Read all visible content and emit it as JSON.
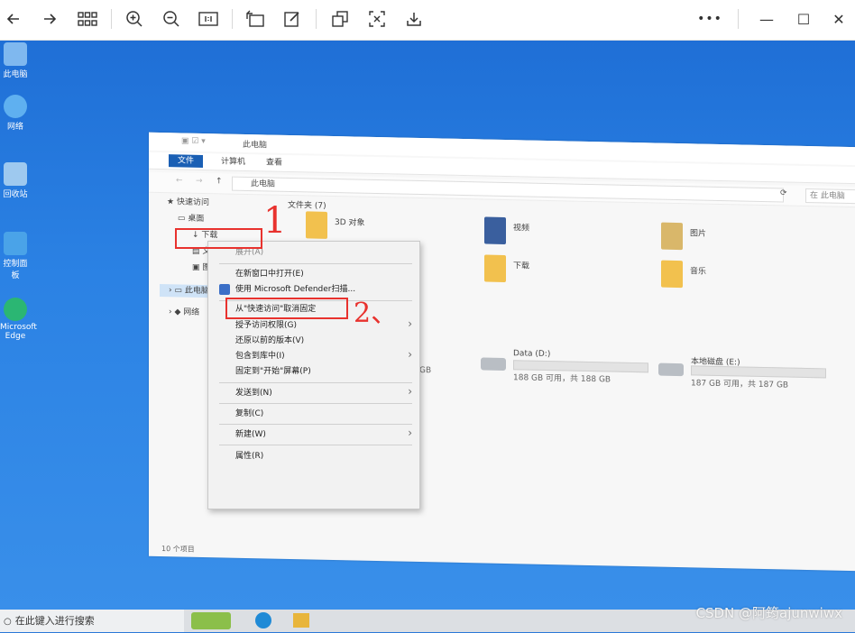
{
  "viewer": {
    "toolbar_icons": [
      "arrow-left-icon",
      "arrow-right-icon",
      "grid-icon",
      "zoom-in-icon",
      "zoom-out-icon",
      "actual-size-icon",
      "rotate-icon",
      "edit-icon",
      "crop-icon",
      "fit-icon",
      "save-icon"
    ],
    "more_label": "•••",
    "minimize_label": "—",
    "maximize_label": "☐",
    "close_label": "✕"
  },
  "desktop": {
    "icons": [
      {
        "label": "此电脑"
      },
      {
        "label": "网络"
      },
      {
        "label": "回收站"
      },
      {
        "label": "控制面板"
      },
      {
        "label": "Microsoft Edge"
      }
    ]
  },
  "explorer": {
    "title": "此电脑",
    "ribbon": {
      "file": "文件",
      "computer": "计算机",
      "view": "查看"
    },
    "address": "此电脑",
    "search_placeholder": "在 此电脑",
    "nav": {
      "quick_access": "快速访问",
      "desktop": "桌面",
      "downloads": "下载",
      "documents": "文档",
      "pictures": "图片",
      "this_pc": "此电脑",
      "network": "网络"
    },
    "folders_header": "文件夹 (7)",
    "folders": [
      {
        "name": "3D 对象"
      },
      {
        "name": "视频"
      },
      {
        "name": "图片"
      },
      {
        "name": "下载"
      },
      {
        "name": "音乐"
      }
    ],
    "drives": [
      {
        "name": "Data (D:)",
        "free": "188 GB 可用，共 188 GB"
      },
      {
        "name": "本地磁盘 (E:)",
        "free": "187 GB 可用，共 187 GB"
      }
    ],
    "partial_drive_text": "GB",
    "status": "10 个项目"
  },
  "context_menu": {
    "items": [
      {
        "label": "展开(A)"
      },
      {
        "label": "在新窗口中打开(E)"
      },
      {
        "label": "使用 Microsoft Defender扫描..."
      },
      {
        "label": "从\"快速访问\"取消固定"
      },
      {
        "label": "授予访问权限(G)"
      },
      {
        "label": "还原以前的版本(V)"
      },
      {
        "label": "包含到库中(I)"
      },
      {
        "label": "固定到\"开始\"屏幕(P)"
      },
      {
        "label": "发送到(N)"
      },
      {
        "label": "复制(C)"
      },
      {
        "label": "新建(W)"
      },
      {
        "label": "属性(R)"
      }
    ]
  },
  "annotations": {
    "step1": "1",
    "step2": "2、"
  },
  "taskbar": {
    "search": "在此键入进行搜索"
  },
  "watermark": "CSDN @阿筠ajunwiwx",
  "colors": {
    "desktop": "#2a78d8",
    "ribbon_file": "#1a5fb4",
    "annotation": "#e8322e"
  }
}
